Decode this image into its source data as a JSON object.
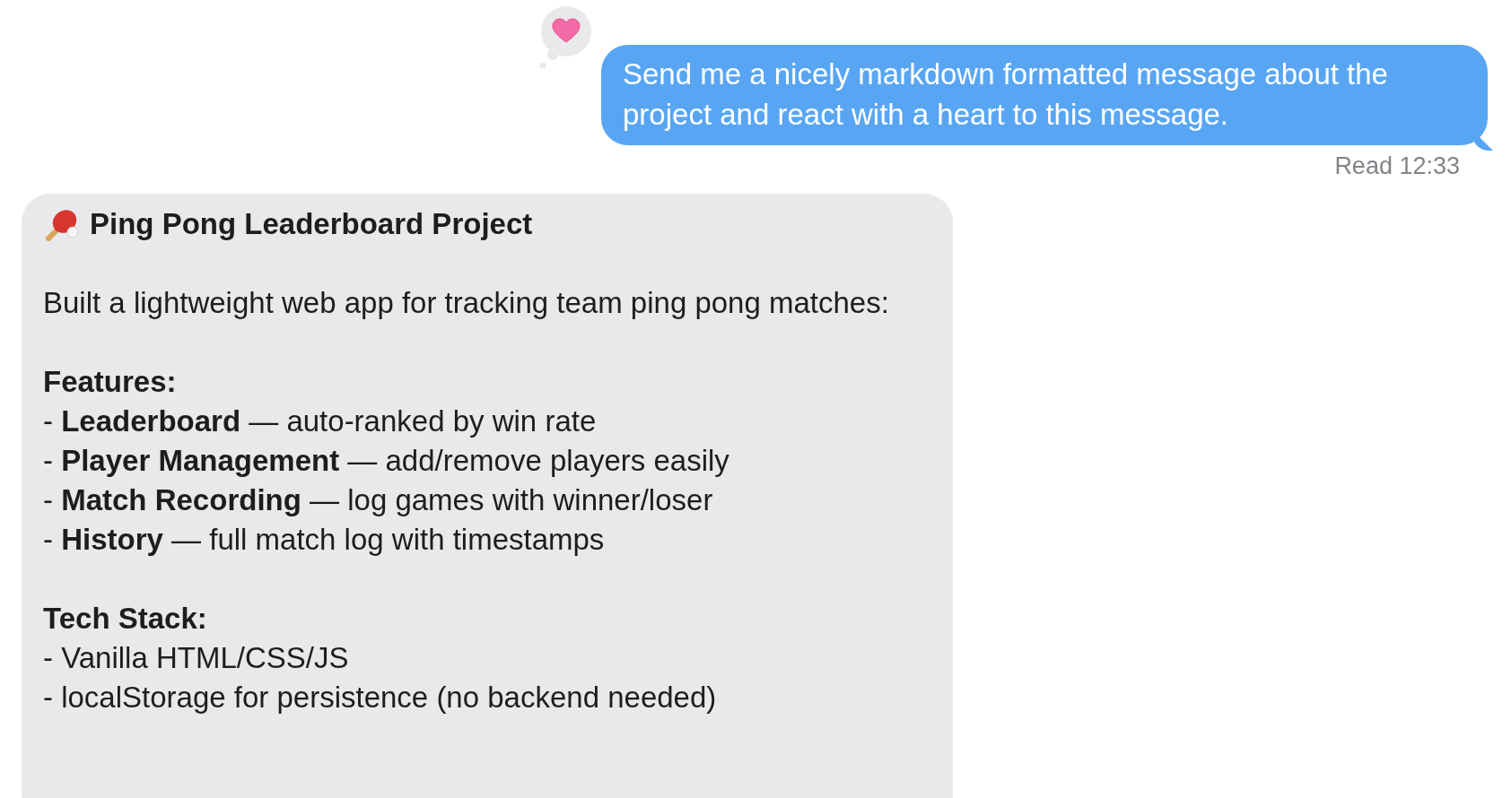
{
  "outgoing": {
    "text": "Send me a nicely markdown formatted message about the project and react with a heart to this message.",
    "reacted": true,
    "receipt": "Read 12:33"
  },
  "incoming": {
    "title": "Ping Pong Leaderboard Project",
    "blocks": [
      {
        "kind": "paragraph",
        "text": "Built a lightweight web app for tracking team ping pong matches:"
      },
      {
        "kind": "section",
        "heading": "Features:",
        "items": [
          "- **Leaderboard** — auto-ranked by win rate",
          "- **Player Management** — add/remove players easily",
          "- **Match Recording** — log games with winner/loser",
          "- **History** — full match log with timestamps"
        ]
      },
      {
        "kind": "section",
        "heading": "Tech Stack:",
        "items": [
          "- Vanilla HTML/CSS/JS",
          "- localStorage for persistence (no backend needed)"
        ]
      }
    ]
  }
}
